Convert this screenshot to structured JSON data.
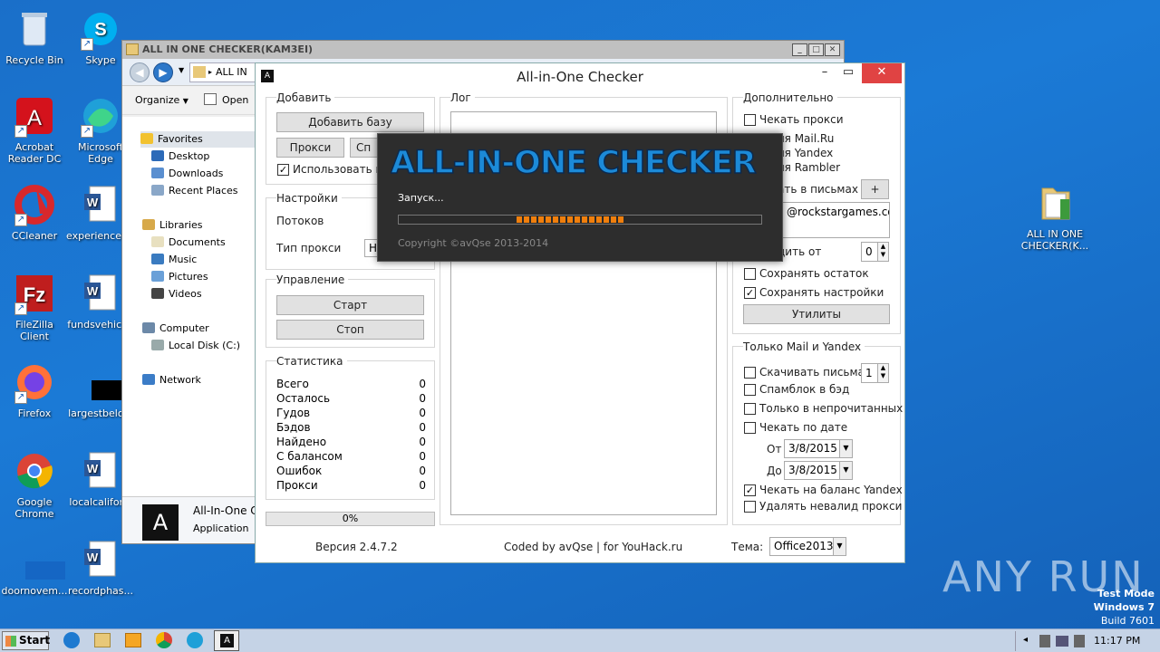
{
  "desktop": {
    "icons": [
      {
        "label": "Recycle Bin",
        "icon": "recycle-bin-icon"
      },
      {
        "label": "Skype",
        "icon": "skype-icon"
      },
      {
        "label": "Acrobat Reader DC",
        "icon": "acrobat-icon"
      },
      {
        "label": "Microsoft Edge",
        "icon": "edge-icon"
      },
      {
        "label": "CCleaner",
        "icon": "ccleaner-icon"
      },
      {
        "label": "experiencea...",
        "icon": "word-doc-icon"
      },
      {
        "label": "FileZilla Client",
        "icon": "filezilla-icon"
      },
      {
        "label": "fundsvehicl...",
        "icon": "word-doc-icon"
      },
      {
        "label": "Firefox",
        "icon": "firefox-icon"
      },
      {
        "label": "largestbelo...",
        "icon": "black-file-icon"
      },
      {
        "label": "Google Chrome",
        "icon": "chrome-icon"
      },
      {
        "label": "localcalifor...",
        "icon": "word-doc-icon"
      },
      {
        "label": "doornovem...",
        "icon": "blank-file-icon"
      },
      {
        "label": "recordphas...",
        "icon": "word-doc-icon"
      },
      {
        "label": "ALL IN ONE CHECKER(K...",
        "icon": "folder-icon"
      }
    ],
    "watermark": "ANY RUN",
    "test_mode": {
      "line1": "Test Mode",
      "line2": "Windows 7",
      "line3": "Build 7601"
    }
  },
  "explorer": {
    "title": "ALL IN ONE CHECKER(KAM3EI)",
    "address": "ALL IN",
    "organize": "Organize",
    "open": "Open",
    "nav": {
      "favorites": "Favorites",
      "desktop": "Desktop",
      "downloads": "Downloads",
      "recent": "Recent Places",
      "libraries": "Libraries",
      "documents": "Documents",
      "music": "Music",
      "pictures": "Pictures",
      "videos": "Videos",
      "computer": "Computer",
      "local_disk": "Local Disk (C:)",
      "network": "Network"
    },
    "details": {
      "name": "All-In-One C",
      "type": "Application",
      "icon_letter": "A"
    }
  },
  "app": {
    "title": "All-in-One Checker",
    "icon_letter": "A",
    "add_group": {
      "label": "Добавить",
      "add_db": "Добавить базу",
      "proxy": "Прокси",
      "sp": "Сп",
      "use_proxy": "Использовать пр"
    },
    "settings_group": {
      "label": "Настройки",
      "threads": "Потоков",
      "proxy_type": "Тип прокси",
      "proxy_type_value": "Н"
    },
    "control_group": {
      "label": "Управление",
      "start": "Старт",
      "stop": "Стоп"
    },
    "stats_group": {
      "label": "Статистика",
      "rows": [
        {
          "name": "Всего",
          "value": "0"
        },
        {
          "name": "Осталось",
          "value": "0"
        },
        {
          "name": "Гудов",
          "value": "0"
        },
        {
          "name": "Бэдов",
          "value": "0"
        },
        {
          "name": "Найдено",
          "value": "0"
        },
        {
          "name": "С балансом",
          "value": "0"
        },
        {
          "name": "Ошибок",
          "value": "0"
        },
        {
          "name": "Прокси",
          "value": "0"
        }
      ]
    },
    "progress_text": "0%",
    "log_label": "Лог",
    "extra_group": {
      "label": "Дополнительно",
      "check_proxy": "Чекать прокси",
      "mailru": "ля Mail.Ru",
      "yandex": "ля Yandex",
      "rambler": "ля Rambler",
      "in_letters": "ать в письмах",
      "plus": "+",
      "search_value": "@rockstargames.co",
      "from_label": "дить от",
      "from_value": "0",
      "save_rest": "Сохранять остаток",
      "save_settings": "Сохранять настройки",
      "utilities": "Утилиты"
    },
    "mail_group": {
      "label": "Только Mail и Yandex",
      "download": "Скачивать письма",
      "download_value": "1",
      "spamblock": "Спамблок в бэд",
      "unread": "Только в непрочитанных",
      "by_date": "Чекать по дате",
      "from": "От",
      "from_date": "3/8/2015",
      "to": "До",
      "to_date": "3/8/2015",
      "yandex_balance": "Чекать на баланс Yandex",
      "delete_invalid": "Удалять невалид прокси"
    },
    "footer": {
      "version": "Версия 2.4.7.2",
      "coded": "Coded by avQse | for YouHack.ru",
      "theme_label": "Тема:",
      "theme_value": "Office2013"
    }
  },
  "splash": {
    "logo": "ALL-IN-ONE CHECKER",
    "status": "Запуск...",
    "copyright": "Copyright ©avQse  2013-2014",
    "progress": 0.45
  },
  "taskbar": {
    "start": "Start",
    "time": "11:17 PM"
  }
}
